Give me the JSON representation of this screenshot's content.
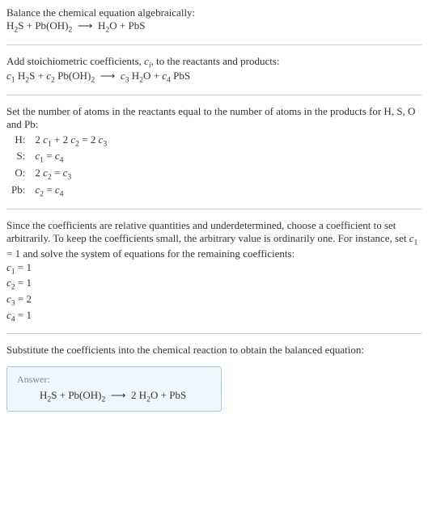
{
  "intro_line": "Balance the chemical equation algebraically:",
  "eq1": "H<sub>2</sub>S + Pb(OH)<sub>2</sub>&nbsp;&nbsp;⟶&nbsp;&nbsp;H<sub>2</sub>O + PbS",
  "step2_line1": "Add stoichiometric coefficients, <span class='italic'>c<sub>i</sub></span>, to the reactants and products:",
  "eq2": "<span class='italic'>c</span><sub>1</sub> H<sub>2</sub>S + <span class='italic'>c</span><sub>2</sub> Pb(OH)<sub>2</sub>&nbsp;&nbsp;⟶&nbsp;&nbsp;<span class='italic'>c</span><sub>3</sub> H<sub>2</sub>O + <span class='italic'>c</span><sub>4</sub> PbS",
  "step3_text": "Set the number of atoms in the reactants equal to the number of atoms in the products for H, S, O and Pb:",
  "atoms": [
    {
      "el": "H:",
      "eq": "2 <span class='italic'>c</span><sub>1</sub> + 2 <span class='italic'>c</span><sub>2</sub> = 2 <span class='italic'>c</span><sub>3</sub>"
    },
    {
      "el": "S:",
      "eq": "<span class='italic'>c</span><sub>1</sub> = <span class='italic'>c</span><sub>4</sub>"
    },
    {
      "el": "O:",
      "eq": "2 <span class='italic'>c</span><sub>2</sub> = <span class='italic'>c</span><sub>3</sub>"
    },
    {
      "el": "Pb:",
      "eq": "<span class='italic'>c</span><sub>2</sub> = <span class='italic'>c</span><sub>4</sub>"
    }
  ],
  "step4_text": "Since the coefficients are relative quantities and underdetermined, choose a coefficient to set arbitrarily. To keep the coefficients small, the arbitrary value is ordinarily one. For instance, set <span class='italic'>c</span><sub>1</sub> = 1 and solve the system of equations for the remaining coefficients:",
  "coeffs": [
    "<span class='italic'>c</span><sub>1</sub> = 1",
    "<span class='italic'>c</span><sub>2</sub> = 1",
    "<span class='italic'>c</span><sub>3</sub> = 2",
    "<span class='italic'>c</span><sub>4</sub> = 1"
  ],
  "step5_text": "Substitute the coefficients into the chemical reaction to obtain the balanced equation:",
  "answer_label": "Answer:",
  "answer_eq": "H<sub>2</sub>S + Pb(OH)<sub>2</sub>&nbsp;&nbsp;⟶&nbsp;&nbsp;2 H<sub>2</sub>O + PbS"
}
